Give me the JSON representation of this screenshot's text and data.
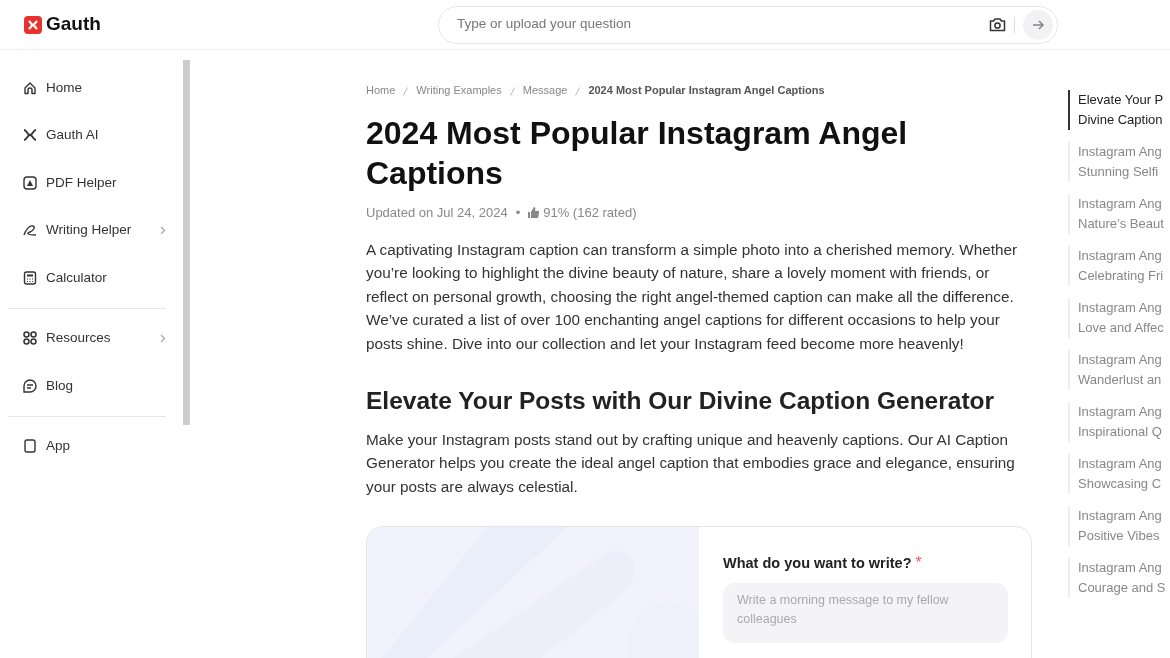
{
  "header": {
    "logo": "Gauth",
    "search": {
      "placeholder": "Type or upload your question"
    }
  },
  "sidebar": {
    "sections": [
      {
        "items": [
          {
            "kind": "home",
            "label": "Home",
            "has_arrow": false
          },
          {
            "kind": "ai",
            "label": "Gauth AI",
            "has_arrow": false
          },
          {
            "kind": "pdf",
            "label": "PDF Helper",
            "has_arrow": false
          },
          {
            "kind": "pen",
            "label": "Writing Helper",
            "has_arrow": true
          },
          {
            "kind": "calc",
            "label": "Calculator",
            "has_arrow": false
          }
        ]
      },
      {
        "items": [
          {
            "kind": "grid",
            "label": "Resources",
            "has_arrow": true
          },
          {
            "kind": "blog",
            "label": "Blog",
            "has_arrow": false
          }
        ]
      },
      {
        "items": [
          {
            "kind": "app",
            "label": "App",
            "has_arrow": false
          }
        ]
      }
    ]
  },
  "breadcrumb": [
    "Home",
    "Writing Examples",
    "Message",
    "2024 Most Popular Instagram Angel Captions"
  ],
  "article": {
    "title": "2024 Most Popular Instagram Angel Captions",
    "updated": "Updated on Jul 24, 2024",
    "separator": "•",
    "rating": "91% (162 rated)",
    "intro": "A captivating Instagram caption can transform a simple photo into a cherished memory. Whether you’re looking to highlight the divine beauty of nature, share a lovely moment with friends, or reflect on personal growth, choosing the right angel-themed caption can make all the difference. We’ve curated a list of over 100 enchanting angel captions for different occasions to help your posts shine. Dive into our collection and let your Instagram feed become more heavenly!",
    "section_title": "Elevate Your Posts with Our Divine Caption Generator",
    "section_text": "Make your Instagram posts stand out by crafting unique and heavenly captions. Our AI Caption Generator helps you create the ideal angel caption that embodies grace and elegance, ensuring your posts are always celestial."
  },
  "generator": {
    "label": "What do you want to write?",
    "required_mark": "*",
    "placeholder": "Write a morning message to my fellow colleagues"
  },
  "toc": [
    {
      "lines": [
        "Elevate Your P",
        "Divine Caption"
      ],
      "selected": true
    },
    {
      "lines": [
        "Instagram Ang",
        "Stunning Selfi"
      ],
      "selected": false
    },
    {
      "lines": [
        "Instagram Ang",
        "Nature’s Beaut"
      ],
      "selected": false
    },
    {
      "lines": [
        "Instagram Ang",
        "Celebrating Fri"
      ],
      "selected": false
    },
    {
      "lines": [
        "Instagram Ang",
        "Love and Affec"
      ],
      "selected": false
    },
    {
      "lines": [
        "Instagram Ang",
        "Wanderlust an"
      ],
      "selected": false
    },
    {
      "lines": [
        "Instagram Ang",
        "Inspirational Q"
      ],
      "selected": false
    },
    {
      "lines": [
        "Instagram Ang",
        "Showcasing C"
      ],
      "selected": false
    },
    {
      "lines": [
        "Instagram Ang",
        "Positive Vibes"
      ],
      "selected": false
    },
    {
      "lines": [
        "Instagram Ang",
        "Courage and S"
      ],
      "selected": false
    }
  ]
}
